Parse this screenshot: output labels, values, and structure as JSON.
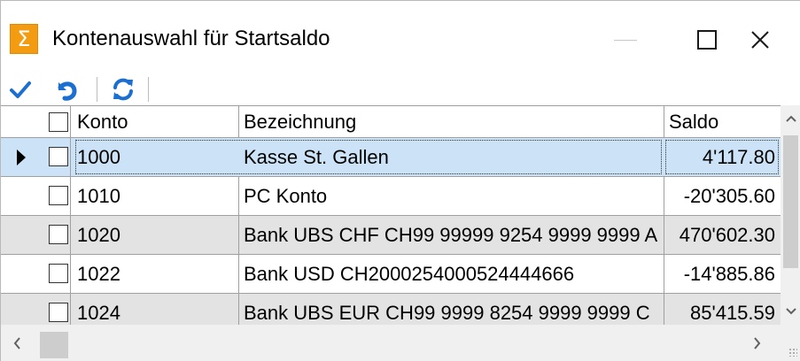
{
  "window": {
    "title": "Kontenauswahl für Startsaldo",
    "app_icon_glyph": "Σ",
    "close_glyph": "✕"
  },
  "toolbar": {
    "icons": [
      "checkmark-icon",
      "undo-icon",
      "refresh-icon"
    ]
  },
  "table": {
    "columns": [
      "Konto",
      "Bezeichnung",
      "Saldo"
    ],
    "rows": [
      {
        "konto": "1000",
        "bezeichnung": "Kasse St. Gallen",
        "saldo": "4'117.80",
        "selected": true
      },
      {
        "konto": "1010",
        "bezeichnung": "PC Konto",
        "saldo": "-20'305.60",
        "selected": false
      },
      {
        "konto": "1020",
        "bezeichnung": "Bank UBS CHF CH99 99999 9254 9999 9999 A",
        "saldo": "470'602.30",
        "selected": false
      },
      {
        "konto": "1022",
        "bezeichnung": "Bank USD CH2000254000524444666",
        "saldo": "-14'885.86",
        "selected": false
      },
      {
        "konto": "1024",
        "bezeichnung": "Bank UBS EUR CH99 9999  8254 9999 9999 C",
        "saldo": "85'415.59",
        "selected": false
      }
    ]
  },
  "scrollbar": {
    "up": "^",
    "down": "v",
    "left": "<",
    "right": ">"
  },
  "colors": {
    "accent": "#1b6fd1",
    "selected_row": "#cce3f7",
    "alt_row": "#e3e3e3",
    "app_icon": "#f39c12"
  }
}
